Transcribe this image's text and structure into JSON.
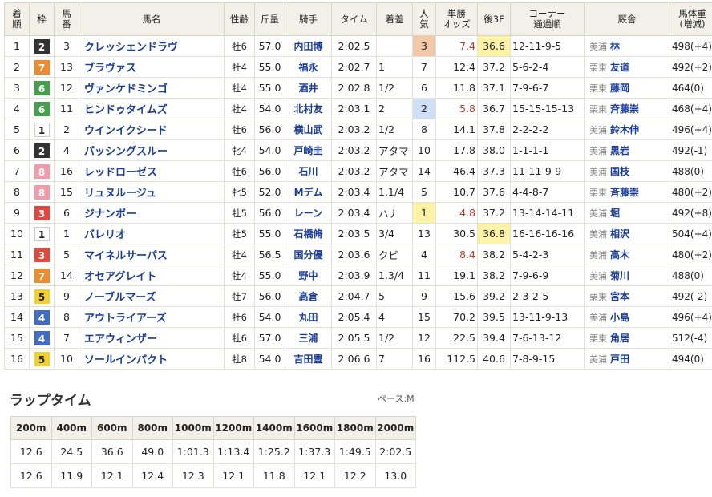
{
  "headers": {
    "pos": "着\n順",
    "waku": "枠",
    "num": "馬\n番",
    "name": "馬名",
    "sex": "性齢",
    "weight": "斤量",
    "jockey": "騎手",
    "time": "タイム",
    "margin": "着差",
    "pop": "人\n気",
    "odds": "単勝\nオッズ",
    "f3": "後3F",
    "corner": "コーナー\n通過順",
    "trainer": "厩舎",
    "bw": "馬体重\n(増減)"
  },
  "waku_colors": {
    "1": {
      "bg": "#ffffff",
      "fg": "#222222",
      "border": "#cccccc"
    },
    "2": {
      "bg": "#333333",
      "fg": "#ffffff",
      "border": "#333333"
    },
    "3": {
      "bg": "#e2463d",
      "fg": "#ffffff",
      "border": "#e2463d"
    },
    "4": {
      "bg": "#3f6cc7",
      "fg": "#ffffff",
      "border": "#3f6cc7"
    },
    "5": {
      "bg": "#f2d02a",
      "fg": "#222222",
      "border": "#f2d02a"
    },
    "6": {
      "bg": "#45a04a",
      "fg": "#ffffff",
      "border": "#45a04a"
    },
    "7": {
      "bg": "#f08a2a",
      "fg": "#ffffff",
      "border": "#f08a2a"
    },
    "8": {
      "bg": "#f29aa8",
      "fg": "#ffffff",
      "border": "#f29aa8"
    }
  },
  "rows": [
    {
      "pos": "1",
      "waku": "2",
      "num": "3",
      "name": "クレッシェンドラヴ",
      "sex": "牡6",
      "weight": "57.0",
      "jockey": "内田博",
      "time": "2:02.5",
      "margin": "",
      "pop": "3",
      "odds": "7.4",
      "f3": "36.6",
      "corner": "12-11-9-5",
      "region": "美浦",
      "trainer": "林",
      "bw": "498(+4)",
      "pop_hl": "pop3",
      "odds_hl": true,
      "f3_hl": true
    },
    {
      "pos": "2",
      "waku": "7",
      "num": "13",
      "name": "ブラヴァス",
      "sex": "牡4",
      "weight": "55.0",
      "jockey": "福永",
      "time": "2:02.7",
      "margin": "1",
      "pop": "7",
      "odds": "12.4",
      "f3": "37.2",
      "corner": "5-6-2-4",
      "region": "栗東",
      "trainer": "友道",
      "bw": "492(+2)",
      "pop_hl": "",
      "odds_hl": false,
      "f3_hl": false
    },
    {
      "pos": "3",
      "waku": "6",
      "num": "12",
      "name": "ヴァンケドミンゴ",
      "sex": "牡4",
      "weight": "55.0",
      "jockey": "酒井",
      "time": "2:02.8",
      "margin": "1/2",
      "pop": "6",
      "odds": "11.8",
      "f3": "37.1",
      "corner": "7-9-6-7",
      "region": "栗東",
      "trainer": "藤岡",
      "bw": "464(0)",
      "pop_hl": "",
      "odds_hl": false,
      "f3_hl": false
    },
    {
      "pos": "4",
      "waku": "6",
      "num": "11",
      "name": "ヒンドゥタイムズ",
      "sex": "牡4",
      "weight": "54.0",
      "jockey": "北村友",
      "time": "2:03.1",
      "margin": "2",
      "pop": "2",
      "odds": "5.8",
      "f3": "36.7",
      "corner": "15-15-15-13",
      "region": "栗東",
      "trainer": "斉藤崇",
      "bw": "468(+4)",
      "pop_hl": "pop2",
      "odds_hl": true,
      "f3_hl": false
    },
    {
      "pos": "5",
      "waku": "1",
      "num": "2",
      "name": "ウインイクシード",
      "sex": "牡6",
      "weight": "56.0",
      "jockey": "横山武",
      "time": "2:03.2",
      "margin": "1/2",
      "pop": "8",
      "odds": "14.1",
      "f3": "37.8",
      "corner": "2-2-2-2",
      "region": "美浦",
      "trainer": "鈴木伸",
      "bw": "496(+4)",
      "pop_hl": "",
      "odds_hl": false,
      "f3_hl": false
    },
    {
      "pos": "6",
      "waku": "2",
      "num": "4",
      "name": "パッシングスルー",
      "sex": "牝4",
      "weight": "54.0",
      "jockey": "戸崎圭",
      "time": "2:03.2",
      "margin": "アタマ",
      "pop": "10",
      "odds": "17.8",
      "f3": "38.0",
      "corner": "1-1-1-1",
      "region": "美浦",
      "trainer": "黒岩",
      "bw": "492(-1)",
      "pop_hl": "",
      "odds_hl": false,
      "f3_hl": false
    },
    {
      "pos": "7",
      "waku": "8",
      "num": "16",
      "name": "レッドローゼス",
      "sex": "牡6",
      "weight": "56.0",
      "jockey": "石川",
      "time": "2:03.2",
      "margin": "アタマ",
      "pop": "14",
      "odds": "46.4",
      "f3": "37.3",
      "corner": "11-11-9-9",
      "region": "美浦",
      "trainer": "国枝",
      "bw": "488(0)",
      "pop_hl": "",
      "odds_hl": false,
      "f3_hl": false
    },
    {
      "pos": "8",
      "waku": "8",
      "num": "15",
      "name": "リュヌルージュ",
      "sex": "牝5",
      "weight": "52.0",
      "jockey": "Mデム",
      "time": "2:03.4",
      "margin": "1.1/4",
      "pop": "5",
      "odds": "10.7",
      "f3": "37.6",
      "corner": "4-4-8-7",
      "region": "栗東",
      "trainer": "斉藤崇",
      "bw": "480(+2)",
      "pop_hl": "",
      "odds_hl": false,
      "f3_hl": false
    },
    {
      "pos": "9",
      "waku": "3",
      "num": "6",
      "name": "ジナンボー",
      "sex": "牡5",
      "weight": "56.0",
      "jockey": "レーン",
      "time": "2:03.4",
      "margin": "ハナ",
      "pop": "1",
      "odds": "4.8",
      "f3": "37.2",
      "corner": "13-14-14-11",
      "region": "美浦",
      "trainer": "堀",
      "bw": "492(+8)",
      "pop_hl": "pop1",
      "odds_hl": true,
      "f3_hl": false
    },
    {
      "pos": "10",
      "waku": "1",
      "num": "1",
      "name": "バレリオ",
      "sex": "牡5",
      "weight": "55.0",
      "jockey": "石橋脩",
      "time": "2:03.5",
      "margin": "3/4",
      "pop": "13",
      "odds": "30.5",
      "f3": "36.8",
      "corner": "16-16-16-16",
      "region": "美浦",
      "trainer": "相沢",
      "bw": "504(+4)",
      "pop_hl": "",
      "odds_hl": false,
      "f3_hl": true
    },
    {
      "pos": "11",
      "waku": "3",
      "num": "5",
      "name": "マイネルサーパス",
      "sex": "牡4",
      "weight": "56.5",
      "jockey": "国分優",
      "time": "2:03.6",
      "margin": "クビ",
      "pop": "4",
      "odds": "8.4",
      "f3": "38.2",
      "corner": "5-4-2-3",
      "region": "美浦",
      "trainer": "高木",
      "bw": "480(+2)",
      "pop_hl": "",
      "odds_hl": true,
      "f3_hl": false
    },
    {
      "pos": "12",
      "waku": "7",
      "num": "14",
      "name": "オセアグレイト",
      "sex": "牡4",
      "weight": "55.0",
      "jockey": "野中",
      "time": "2:03.9",
      "margin": "1.3/4",
      "pop": "11",
      "odds": "19.1",
      "f3": "38.2",
      "corner": "7-9-6-9",
      "region": "美浦",
      "trainer": "菊川",
      "bw": "488(0)",
      "pop_hl": "",
      "odds_hl": false,
      "f3_hl": false
    },
    {
      "pos": "13",
      "waku": "5",
      "num": "9",
      "name": "ノーブルマーズ",
      "sex": "牡7",
      "weight": "56.0",
      "jockey": "高倉",
      "time": "2:04.7",
      "margin": "5",
      "pop": "9",
      "odds": "15.6",
      "f3": "39.2",
      "corner": "2-3-2-5",
      "region": "栗東",
      "trainer": "宮本",
      "bw": "492(-2)",
      "pop_hl": "",
      "odds_hl": false,
      "f3_hl": false
    },
    {
      "pos": "14",
      "waku": "4",
      "num": "8",
      "name": "アウトライアーズ",
      "sex": "牡6",
      "weight": "54.0",
      "jockey": "丸田",
      "time": "2:05.4",
      "margin": "4",
      "pop": "15",
      "odds": "70.2",
      "f3": "39.5",
      "corner": "13-11-9-13",
      "region": "美浦",
      "trainer": "小島",
      "bw": "496(+4)",
      "pop_hl": "",
      "odds_hl": false,
      "f3_hl": false
    },
    {
      "pos": "15",
      "waku": "4",
      "num": "7",
      "name": "エアウィンザー",
      "sex": "牡6",
      "weight": "57.0",
      "jockey": "三浦",
      "time": "2:05.5",
      "margin": "1/2",
      "pop": "12",
      "odds": "22.5",
      "f3": "39.4",
      "corner": "7-6-13-12",
      "region": "栗東",
      "trainer": "角居",
      "bw": "512(-4)",
      "pop_hl": "",
      "odds_hl": false,
      "f3_hl": false
    },
    {
      "pos": "16",
      "waku": "5",
      "num": "10",
      "name": "ソールインパクト",
      "sex": "牡8",
      "weight": "54.0",
      "jockey": "吉田豊",
      "time": "2:06.6",
      "margin": "7",
      "pop": "16",
      "odds": "112.5",
      "f3": "40.6",
      "corner": "7-8-9-15",
      "region": "美浦",
      "trainer": "戸田",
      "bw": "494(0)",
      "pop_hl": "",
      "odds_hl": false,
      "f3_hl": false
    }
  ],
  "lap": {
    "title": "ラップタイム",
    "pace": "ペース:M",
    "distances": [
      "200m",
      "400m",
      "600m",
      "800m",
      "1000m",
      "1200m",
      "1400m",
      "1600m",
      "1800m",
      "2000m"
    ],
    "cumulative": [
      "12.6",
      "24.5",
      "36.6",
      "49.0",
      "1:01.3",
      "1:13.4",
      "1:25.2",
      "1:37.3",
      "1:49.5",
      "2:02.5"
    ],
    "splits": [
      "12.6",
      "11.9",
      "12.1",
      "12.4",
      "12.3",
      "12.1",
      "11.8",
      "12.1",
      "12.2",
      "13.0"
    ]
  }
}
